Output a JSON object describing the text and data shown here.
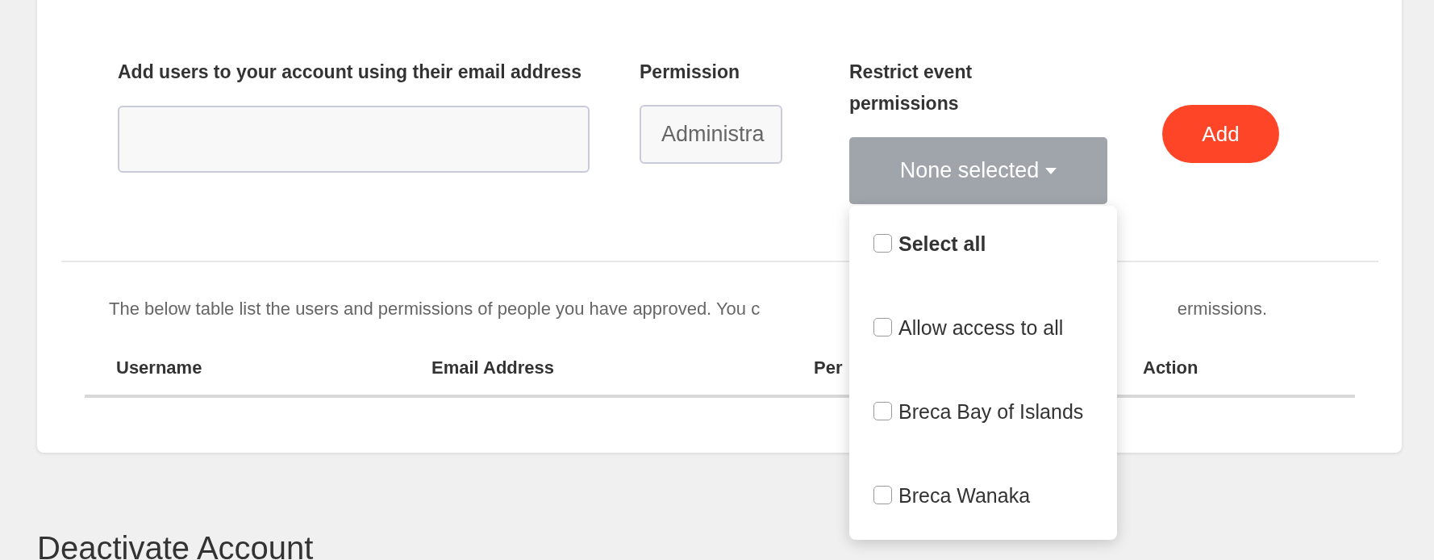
{
  "add_user_form": {
    "email": {
      "label": "Add users to your account using their email address"
    },
    "permission": {
      "label": "Permission",
      "value": "Administra"
    },
    "restrict": {
      "label": "Restrict event permissions",
      "button": "None selected",
      "expanded": true,
      "options": [
        {
          "label": "Select all",
          "checked": false,
          "kind": "select-all"
        },
        {
          "label": "Allow access to all",
          "checked": false,
          "kind": "option"
        },
        {
          "label": "Breca Bay of Islands",
          "checked": false,
          "kind": "option"
        },
        {
          "label": "Breca Wanaka",
          "checked": false,
          "kind": "option"
        }
      ]
    },
    "add_button": "Add"
  },
  "users_table": {
    "description": [
      "The below table list the users and permissions of people you have approved. You c",
      "ermissions."
    ],
    "columns": [
      "Username",
      "Email Address",
      "Per",
      "Action"
    ]
  },
  "next_section": {
    "title": "Deactivate Account"
  }
}
